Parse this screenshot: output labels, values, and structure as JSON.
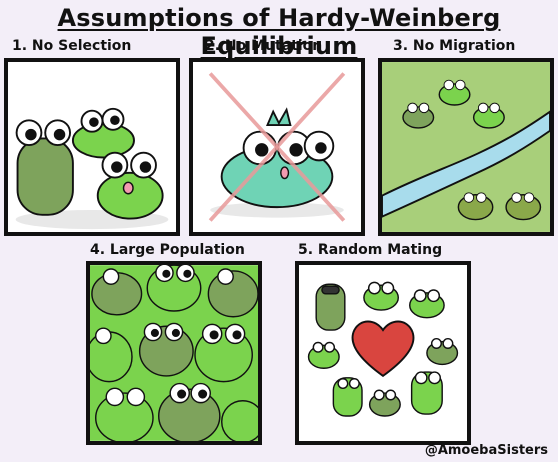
{
  "title": "Assumptions of Hardy-Weinberg Equilibrium",
  "panels": [
    {
      "label": "1. No Selection"
    },
    {
      "label": "2. No Mutation"
    },
    {
      "label": "3. No Migration"
    },
    {
      "label": "4. Large Population"
    },
    {
      "label": "5. Random Mating"
    }
  ],
  "handle": "@AmoebaSisters",
  "colors": {
    "frog_light": "#7bd34d",
    "frog_dark": "#7ea35c",
    "frog_blue": "#6fd3b5",
    "river": "#a8dcec",
    "grass": "#a8cf7a",
    "heart": "#d9453f",
    "cross": "#e89a9a",
    "background": "#f3eef8"
  }
}
